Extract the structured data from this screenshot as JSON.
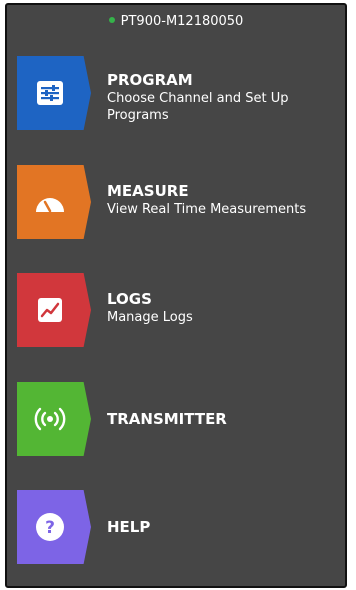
{
  "header": {
    "device_name": "PT900-M12180050",
    "status_color": "#35b34a"
  },
  "menu": [
    {
      "id": "program",
      "title": "PROGRAM",
      "subtitle": "Choose Channel and Set Up Programs",
      "color": "#1e64c3",
      "icon": "settings-sliders-icon"
    },
    {
      "id": "measure",
      "title": "MEASURE",
      "subtitle": "View Real Time Measurements",
      "color": "#e27524",
      "icon": "gauge-icon"
    },
    {
      "id": "logs",
      "title": "LOGS",
      "subtitle": "Manage Logs",
      "color": "#d1373c",
      "icon": "chart-icon"
    },
    {
      "id": "transmitter",
      "title": "TRANSMITTER",
      "subtitle": "",
      "color": "#53b634",
      "icon": "broadcast-icon"
    },
    {
      "id": "help",
      "title": "HELP",
      "subtitle": "",
      "color": "#7d64e6",
      "icon": "question-icon"
    }
  ]
}
